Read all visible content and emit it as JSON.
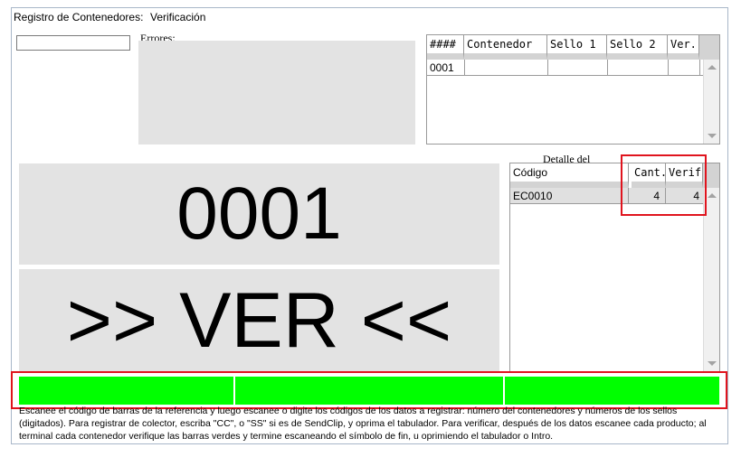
{
  "header": {
    "title": "Registro de Contenedores:",
    "mode": "Verificación"
  },
  "scan_input": {
    "value": "",
    "placeholder": ""
  },
  "errors": {
    "label": "Errores:",
    "text": ""
  },
  "containers_grid": {
    "columns": [
      "####",
      "Contenedor",
      "Sello 1",
      "Sello 2",
      "Ver."
    ],
    "rows": [
      {
        "num": "0001",
        "contenedor": "",
        "sello1": "",
        "sello2": "",
        "ver": ""
      }
    ]
  },
  "display": {
    "container_number": "0001",
    "status": ">> VER <<"
  },
  "detail": {
    "title": "Detalle del",
    "columns": [
      "Código",
      "Cant.",
      "Verif."
    ],
    "rows": [
      {
        "codigo": "EC0010",
        "cant": "4",
        "verif": "4"
      }
    ]
  },
  "progress": {
    "segments": 3,
    "filled": 3,
    "color": "#00ff00"
  },
  "instructions": "Escanee el código de barras de la referencia y luego escanee o digite los códigos de los datos a registrar: número del contenedores y números de los sellos (digitados). Para registrar de colector, escriba \"CC\", o \"SS\" si es de SendClip, y oprima el tabulador. Para verificar, después de los datos escanee cada producto; al terminal cada contenedor verifique las barras verdes y termine escaneando el símbolo de fin, u oprimiendo el tabulador o Intro.",
  "colors": {
    "accent_green": "#00ff00",
    "highlight_red": "#e0141e",
    "panel_gray": "#e3e3e3"
  }
}
